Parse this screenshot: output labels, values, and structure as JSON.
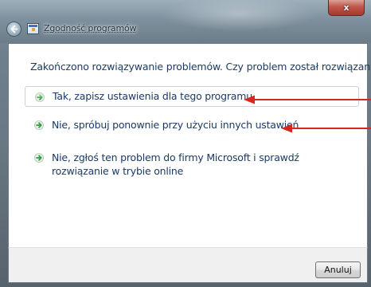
{
  "window": {
    "title": "Zgodność programów",
    "close_glyph": "x"
  },
  "content": {
    "heading": "Zakończono rozwiązywanie problemów. Czy problem został rozwiązany?"
  },
  "options": [
    {
      "label": "Tak, zapisz ustawienia dla tego programu",
      "icon": "green-arrow-icon"
    },
    {
      "label": "Nie, spróbuj ponownie przy użyciu innych ustawień",
      "icon": "green-arrow-icon"
    },
    {
      "label": "Nie, zgłoś ten problem do firmy Microsoft i sprawdź rozwiązanie w trybie online",
      "icon": "green-arrow-icon"
    }
  ],
  "footer": {
    "cancel_label": "Anuluj"
  },
  "colors": {
    "link_text": "#1b3a66",
    "annotation_arrow": "#d9261c",
    "option_arrow": "#3aa14a"
  }
}
